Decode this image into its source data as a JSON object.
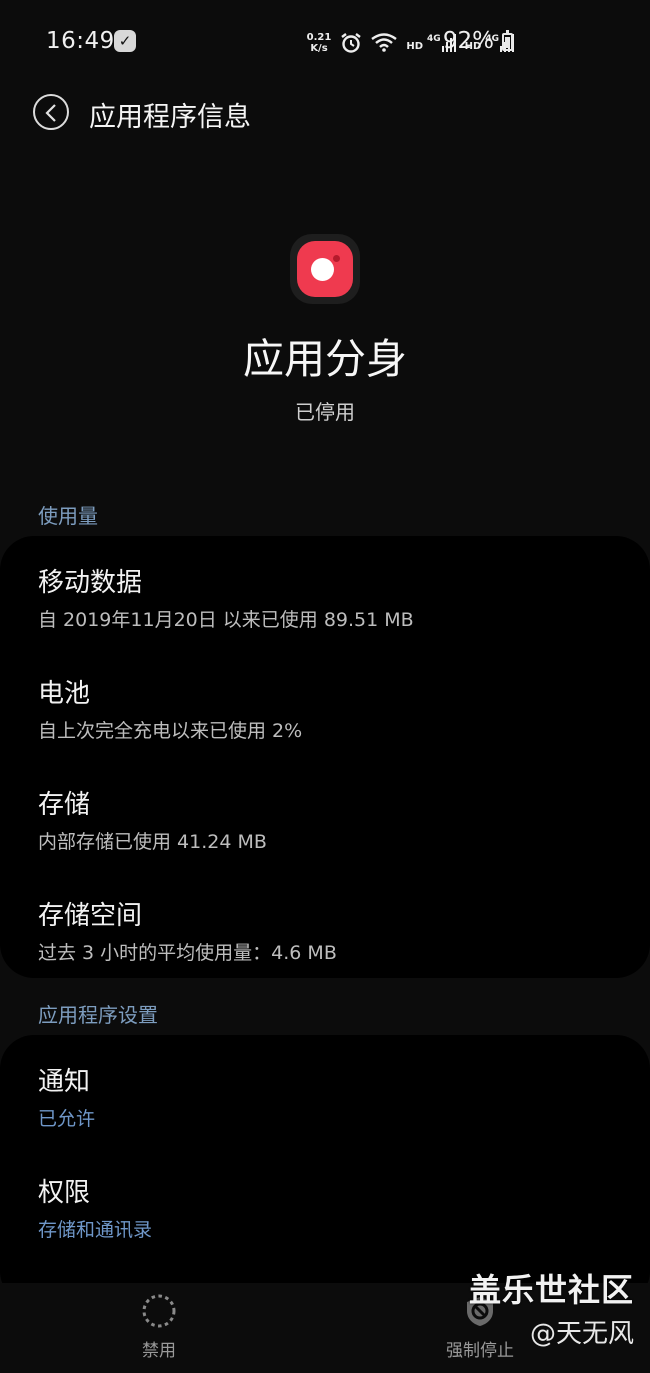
{
  "status_bar": {
    "time": "16:49",
    "net_speed_value": "0.21",
    "net_speed_unit": "K/s",
    "sim1": "HD",
    "sim1_type": "4G",
    "sim2": "HD",
    "sim2_type": "4G",
    "battery": "92%",
    "battery_level": 0.92
  },
  "header": {
    "title": "应用程序信息"
  },
  "app": {
    "name": "应用分身",
    "status": "已停用",
    "icon_color": "#ef3a4f"
  },
  "usage_section": {
    "header": "使用量",
    "items": [
      {
        "title": "移动数据",
        "subtitle": "自 2019年11月20日 以来已使用 89.51 MB"
      },
      {
        "title": "电池",
        "subtitle": "自上次完全充电以来已使用 2%"
      },
      {
        "title": "存储",
        "subtitle": "内部存储已使用 41.24 MB"
      },
      {
        "title": "存储空间",
        "subtitle": "过去 3 小时的平均使用量：4.6 MB"
      }
    ]
  },
  "settings_section": {
    "header": "应用程序设置",
    "items": [
      {
        "title": "通知",
        "subtitle": "已允许"
      },
      {
        "title": "权限",
        "subtitle": "存储和通讯录"
      }
    ]
  },
  "bottom_bar": {
    "disable_label": "禁用",
    "force_stop_label": "强制停止"
  },
  "watermark": {
    "line1": "盖乐世社区",
    "line2": "@天无风"
  },
  "colors": {
    "accent_blue": "#6f97c9",
    "section_header": "#7d9dbf"
  }
}
